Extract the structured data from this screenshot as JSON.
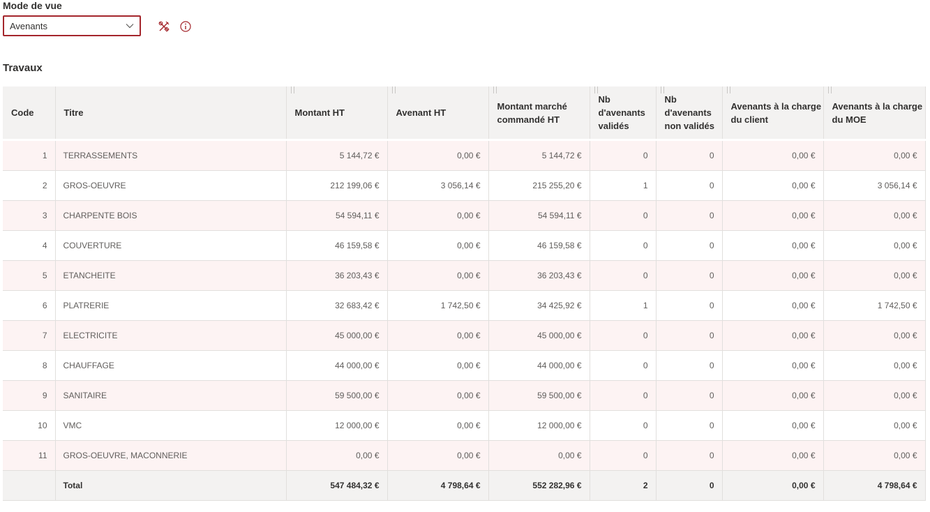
{
  "view_mode": {
    "label": "Mode de vue",
    "selected": "Avenants"
  },
  "toolbar": {
    "icons": [
      "tools-icon",
      "info-icon"
    ]
  },
  "section": {
    "title": "Travaux"
  },
  "table": {
    "columns": [
      "Code",
      "Titre",
      "Montant HT",
      "Avenant HT",
      "Montant marché commandé HT",
      "Nb d'avenants validés",
      "Nb d'avenants non validés",
      "Avenants à la charge du client",
      "Avenants à la charge du MOE"
    ],
    "rows": [
      [
        "1",
        "TERRASSEMENTS",
        "5 144,72 €",
        "0,00 €",
        "5 144,72 €",
        "0",
        "0",
        "0,00 €",
        "0,00 €"
      ],
      [
        "2",
        "GROS-OEUVRE",
        "212 199,06 €",
        "3 056,14 €",
        "215 255,20 €",
        "1",
        "0",
        "0,00 €",
        "3 056,14 €"
      ],
      [
        "3",
        "CHARPENTE BOIS",
        "54 594,11 €",
        "0,00 €",
        "54 594,11 €",
        "0",
        "0",
        "0,00 €",
        "0,00 €"
      ],
      [
        "4",
        "COUVERTURE",
        "46 159,58 €",
        "0,00 €",
        "46 159,58 €",
        "0",
        "0",
        "0,00 €",
        "0,00 €"
      ],
      [
        "5",
        "ETANCHEITE",
        "36 203,43 €",
        "0,00 €",
        "36 203,43 €",
        "0",
        "0",
        "0,00 €",
        "0,00 €"
      ],
      [
        "6",
        "PLATRERIE",
        "32 683,42 €",
        "1 742,50 €",
        "34 425,92 €",
        "1",
        "0",
        "0,00 €",
        "1 742,50 €"
      ],
      [
        "7",
        "ELECTRICITE",
        "45 000,00 €",
        "0,00 €",
        "45 000,00 €",
        "0",
        "0",
        "0,00 €",
        "0,00 €"
      ],
      [
        "8",
        "CHAUFFAGE",
        "44 000,00 €",
        "0,00 €",
        "44 000,00 €",
        "0",
        "0",
        "0,00 €",
        "0,00 €"
      ],
      [
        "9",
        "SANITAIRE",
        "59 500,00 €",
        "0,00 €",
        "59 500,00 €",
        "0",
        "0",
        "0,00 €",
        "0,00 €"
      ],
      [
        "10",
        "VMC",
        "12 000,00 €",
        "0,00 €",
        "12 000,00 €",
        "0",
        "0",
        "0,00 €",
        "0,00 €"
      ],
      [
        "11",
        "GROS-OEUVRE, MACONNERIE",
        "0,00 €",
        "0,00 €",
        "0,00 €",
        "0",
        "0",
        "0,00 €",
        "0,00 €"
      ]
    ],
    "total": [
      "",
      "Total",
      "547 484,32 €",
      "4 798,64 €",
      "552 282,96 €",
      "2",
      "0",
      "0,00 €",
      "4 798,64 €"
    ]
  },
  "colors": {
    "accent": "#a4262c",
    "row_alt": "#fdf3f3",
    "header_bg": "#f3f2f1"
  }
}
